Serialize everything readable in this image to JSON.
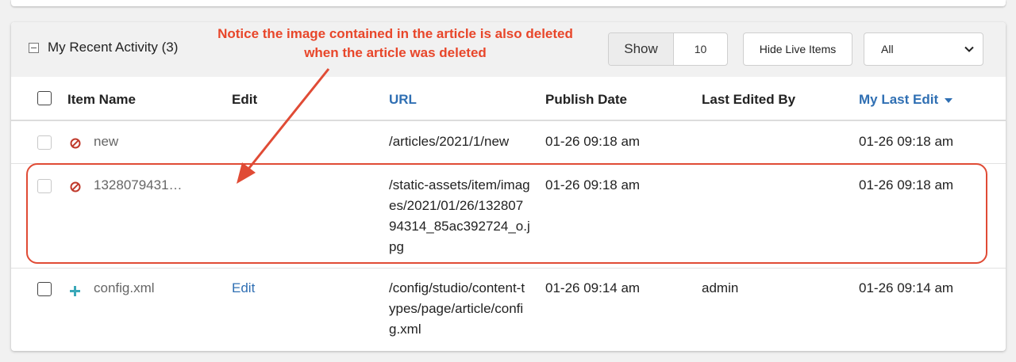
{
  "panel": {
    "title": "My Recent Activity (3)",
    "show_label": "Show",
    "show_value": "10",
    "hide_live_label": "Hide Live Items",
    "filter_value": "All"
  },
  "columns": {
    "item_name": "Item Name",
    "edit": "Edit",
    "url": "URL",
    "publish_date": "Publish Date",
    "last_edited_by": "Last Edited By",
    "my_last_edit": "My Last Edit"
  },
  "rows": [
    {
      "status_icon": "deleted-icon",
      "name": "new",
      "edit": "",
      "url": "/articles/2021/1/new",
      "publish_date": "01-26 09:18 am",
      "last_edited_by": "",
      "my_last_edit": "01-26 09:18 am"
    },
    {
      "status_icon": "deleted-icon",
      "name": "1328079431…",
      "edit": "",
      "url": "/static-assets/item/images/2021/01/26/13280794314_85ac392724_o.jpg",
      "publish_date": "01-26 09:18 am",
      "last_edited_by": "",
      "my_last_edit": "01-26 09:18 am"
    },
    {
      "status_icon": "plus-icon",
      "name": "config.xml",
      "edit": "Edit",
      "url": "/config/studio/content-types/page/article/config.xml",
      "publish_date": "01-26 09:14 am",
      "last_edited_by": "admin",
      "my_last_edit": "01-26 09:14 am"
    }
  ],
  "annotation": {
    "line1": "Notice the image contained in the article is also deleted",
    "line2": "when the article was deleted"
  },
  "colors": {
    "accent_blue": "#2f6fb3",
    "annotation_red": "#e8462a",
    "deleted_red": "#c0392b",
    "plus_teal": "#3aa8b8"
  }
}
